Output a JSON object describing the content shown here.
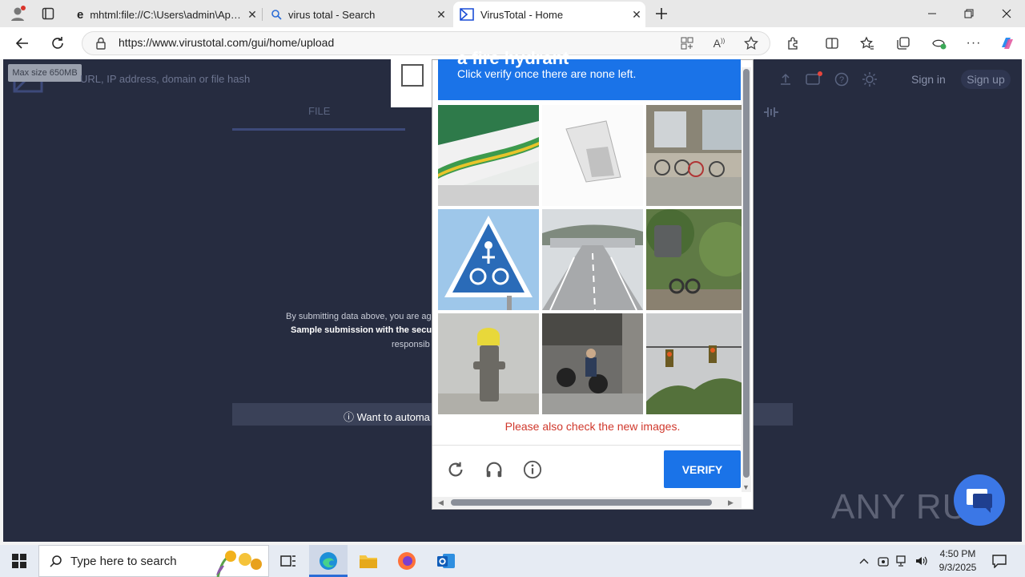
{
  "tabs": [
    {
      "label": "mhtml:file://C:\\Users\\admin\\AppD"
    },
    {
      "label": "virus total - Search"
    },
    {
      "label": "VirusTotal - Home"
    }
  ],
  "address": {
    "url": "https://www.virustotal.com/gui/home/upload"
  },
  "virustotal": {
    "max_size": "Max size 650MB",
    "search_placeholder": "URL, IP address, domain or file hash",
    "sign_in": "Sign in",
    "sign_up": "Sign up",
    "file_tab": "FILE",
    "terms_line1": "By submitting data above, you are ag",
    "terms_line2": "Sample submission with the secu",
    "terms_line3": "responsib",
    "automate": "Want to automa"
  },
  "captcha": {
    "banner_title": "a fire hydrant",
    "instruction": "Click verify once there are none left.",
    "tiles": [
      "bus-side",
      "paper-sign",
      "parked-bicycles",
      "bicycle-crossing-sign",
      "highway-toll",
      "parked-motorbike",
      "fire-hydrant",
      "motorcycles",
      "traffic-lights"
    ],
    "message": "Please also check the new images.",
    "verify_label": "VERIFY",
    "accent": "#1a73e8",
    "error_color": "#d0382c"
  },
  "watermark": {
    "text": "ANY RUN"
  },
  "taskbar": {
    "search_placeholder": "Type here to search",
    "time": "4:50 PM",
    "date": "9/3/2025"
  }
}
